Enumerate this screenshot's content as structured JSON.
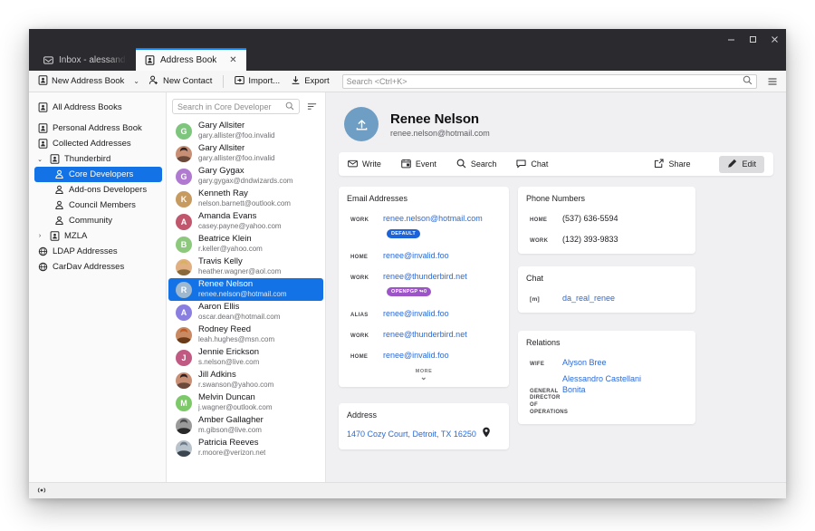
{
  "window": {
    "controls": {
      "minimize": "minimize-button",
      "maximize": "maximize-button",
      "close": "close-button"
    }
  },
  "tabs": [
    {
      "label": "Inbox - alessandro@",
      "icon": "inbox-icon",
      "active": false,
      "closable": false
    },
    {
      "label": "Address Book",
      "icon": "address-book-icon",
      "active": true,
      "closable": true,
      "close_glyph": "✕"
    }
  ],
  "toolbar": {
    "new_address_book": "New Address Book",
    "new_address_book_caret": "⌄",
    "new_contact": "New Contact",
    "import": "Import...",
    "export": "Export",
    "search_placeholder": "Search <Ctrl+K>",
    "menu_glyph": "☰"
  },
  "sidebar": {
    "items": [
      {
        "label": "All Address Books",
        "icon": "address-book-icon",
        "level": 0,
        "twisty": "",
        "selected": false
      },
      {
        "label": "Personal Address Book",
        "icon": "address-book-icon",
        "level": 0,
        "twisty": "",
        "selected": false
      },
      {
        "label": "Collected Addresses",
        "icon": "address-book-icon",
        "level": 0,
        "twisty": "",
        "selected": false
      },
      {
        "label": "Thunderbird",
        "icon": "address-book-icon",
        "level": 0,
        "twisty": "⌄",
        "selected": false
      },
      {
        "label": "Core Developers",
        "icon": "mailing-list-icon",
        "level": 1,
        "twisty": "",
        "selected": true
      },
      {
        "label": "Add-ons Developers",
        "icon": "mailing-list-icon",
        "level": 1,
        "twisty": "",
        "selected": false
      },
      {
        "label": "Council Members",
        "icon": "mailing-list-icon",
        "level": 1,
        "twisty": "",
        "selected": false
      },
      {
        "label": "Community",
        "icon": "mailing-list-icon",
        "level": 1,
        "twisty": "",
        "selected": false
      },
      {
        "label": "MZLA",
        "icon": "address-book-icon",
        "level": 0,
        "twisty": "›",
        "selected": false
      },
      {
        "label": "LDAP Addresses",
        "icon": "ldap-icon",
        "level": 0,
        "twisty": "",
        "selected": false
      },
      {
        "label": "CarDav Addresses",
        "icon": "ldap-icon",
        "level": 0,
        "twisty": "",
        "selected": false
      }
    ]
  },
  "contact_list": {
    "search_placeholder": "Search in Core Developer",
    "sort_icon": "sort-icon",
    "contacts": [
      {
        "name": "Gary Allsiter",
        "email": "gary.allister@foo.invalid",
        "initial": "G",
        "color": "#7ec57e",
        "photo": false,
        "selected": false
      },
      {
        "name": "Gary Allsiter",
        "email": "gary.allister@foo.invalid",
        "initial": "G",
        "color": "#3b3230",
        "photo": true,
        "photo_kind": "woman-dark-hair",
        "selected": false
      },
      {
        "name": "Gary Gygax",
        "email": "gary.gygax@dndwizards.com",
        "initial": "G",
        "color": "#b07ad0",
        "photo": false,
        "selected": false
      },
      {
        "name": "Kenneth Ray",
        "email": "nelson.barnett@outlook.com",
        "initial": "K",
        "color": "#c79a5f",
        "photo": false,
        "selected": false
      },
      {
        "name": "Amanda Evans",
        "email": "casey.payne@yahoo.com",
        "initial": "A",
        "color": "#c0576c",
        "photo": false,
        "selected": false
      },
      {
        "name": "Beatrice Klein",
        "email": "r.keller@yahoo.com",
        "initial": "B",
        "color": "#8dc97c",
        "photo": false,
        "selected": false
      },
      {
        "name": "Travis Kelly",
        "email": "heather.wagner@aol.com",
        "initial": "T",
        "color": "#d9b27c",
        "photo": true,
        "photo_kind": "woman-blonde",
        "selected": false
      },
      {
        "name": "Renee Nelson",
        "email": "renee.nelson@hotmail.com",
        "initial": "R",
        "color": "#9db8cf",
        "photo": false,
        "selected": true
      },
      {
        "name": "Aaron Ellis",
        "email": "oscar.dean@hotmail.com",
        "initial": "A",
        "color": "#8a7ee0",
        "photo": false,
        "selected": false
      },
      {
        "name": "Rodney Reed",
        "email": "leah.hughes@msn.com",
        "initial": "R",
        "color": "#b85b2a",
        "photo": true,
        "photo_kind": "man-orange",
        "selected": false
      },
      {
        "name": "Jennie Erickson",
        "email": "s.nelson@live.com",
        "initial": "J",
        "color": "#c05a82",
        "photo": false,
        "selected": false
      },
      {
        "name": "Jill Adkins",
        "email": "r.swanson@yahoo.com",
        "initial": "J",
        "color": "#4a4048",
        "photo": true,
        "photo_kind": "woman-dark-hair",
        "selected": false
      },
      {
        "name": "Melvin Duncan",
        "email": "j.wagner@outlook.com",
        "initial": "M",
        "color": "#7dc96a",
        "photo": false,
        "selected": false
      },
      {
        "name": "Amber Gallagher",
        "email": "m.gibson@live.com",
        "initial": "A",
        "color": "#5a5a5a",
        "photo": true,
        "photo_kind": "man-grey",
        "selected": false
      },
      {
        "name": "Patricia Reeves",
        "email": "r.moore@verizon.net",
        "initial": "P",
        "color": "#b9c3cc",
        "photo": true,
        "photo_kind": "man-suit",
        "selected": false
      }
    ]
  },
  "detail": {
    "avatar_icon": "upload-avatar-icon",
    "avatar_color": "#6f9ec4",
    "name": "Renee Nelson",
    "email": "renee.nelson@hotmail.com",
    "actions": [
      {
        "label": "Write",
        "icon": "envelope-icon",
        "style": "plain"
      },
      {
        "label": "Event",
        "icon": "calendar-icon",
        "style": "plain"
      },
      {
        "label": "Search",
        "icon": "magnifier-icon",
        "style": "plain"
      },
      {
        "label": "Chat",
        "icon": "chat-bubble-icon",
        "style": "plain"
      },
      {
        "label": "Share",
        "icon": "share-icon",
        "style": "right"
      },
      {
        "label": "Edit",
        "icon": "pencil-icon",
        "style": "pill"
      }
    ],
    "email_card": {
      "title": "Email Addresses",
      "rows": [
        {
          "label": "Work",
          "value": "renee.nelson@hotmail.com",
          "badge": "DEFAULT",
          "badge_kind": "default"
        },
        {
          "label": "Home",
          "value": "renee@invalid.foo",
          "badge": "",
          "badge_kind": ""
        },
        {
          "label": "Work",
          "value": "renee@thunderbird.net",
          "badge": "OPENPGP  ↬0",
          "badge_kind": "openpgp"
        },
        {
          "label": "Alias",
          "value": "renee@invalid.foo",
          "badge": "",
          "badge_kind": ""
        },
        {
          "label": "Work",
          "value": "renee@thunderbird.net",
          "badge": "",
          "badge_kind": ""
        },
        {
          "label": "Home",
          "value": "renee@invalid.foo",
          "badge": "",
          "badge_kind": ""
        }
      ],
      "more_label": "MORE",
      "more_glyph": "⌄"
    },
    "address_card": {
      "title": "Address",
      "value": "1470 Cozy Court, Detroit, TX 16250",
      "map_icon": "map-pin-icon"
    },
    "phone_card": {
      "title": "Phone Numbers",
      "rows": [
        {
          "label": "Home",
          "value": "(537) 636-5594"
        },
        {
          "label": "Work",
          "value": "(132) 393-9833"
        }
      ]
    },
    "chat_card": {
      "title": "Chat",
      "rows": [
        {
          "label": "[m]",
          "value": "da_real_renee"
        }
      ]
    },
    "relations_card": {
      "title": "Relations",
      "rows": [
        {
          "label": "Wife",
          "value": "Alyson Bree"
        },
        {
          "label": "General Director of Operations",
          "value": "Alessandro Castellani Bonita"
        }
      ]
    }
  },
  "statusbar": {
    "icon": "sync-activity-icon"
  }
}
